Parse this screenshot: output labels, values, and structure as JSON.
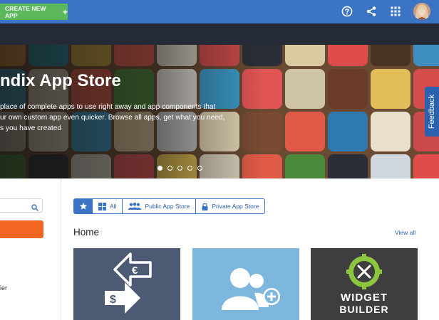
{
  "topbar": {
    "create_button": "CREATE NEW APP",
    "create_icon": "+",
    "icons": [
      "help-icon",
      "share-icon",
      "apps-grid-icon"
    ],
    "avatar": "user-avatar"
  },
  "hero": {
    "title": "ndix App Store",
    "lines": [
      "place of complete apps to use right away and app components that",
      "ur own custom app even quicker. Browse all apps, get what you need,",
      "s you have created"
    ],
    "slides": 5,
    "active_slide": 0
  },
  "feedback": {
    "label": "Feedback"
  },
  "sidebar": {
    "search": {
      "value": "",
      "placeholder": ""
    },
    "partial_text": "ier"
  },
  "filters": {
    "items": [
      {
        "label": "",
        "icon": "star-icon",
        "active": true
      },
      {
        "label": "All",
        "icon": "grid-icon",
        "active": false
      },
      {
        "label": "Public App Store",
        "icon": "users-icon",
        "active": false
      },
      {
        "label": "Private App Store",
        "icon": "lock-icon",
        "active": false
      }
    ]
  },
  "main": {
    "section_title": "Home",
    "view_all": "View all"
  },
  "cards": [
    {
      "name": "currency-exchange-app",
      "icon": "currency-exchange-icon",
      "color": "#4d5a74"
    },
    {
      "name": "add-users-app",
      "icon": "add-users-icon",
      "color": "#7eb7de"
    },
    {
      "name": "widget-builder-app",
      "icon": "gear-tools-icon",
      "color": "#3e3e3e",
      "text_line1": "WIDGET",
      "text_line2": "BUILDER"
    }
  ],
  "colors": {
    "topbar": "#3b74c5",
    "create_button": "#5cb85c",
    "accent_orange": "#f26522",
    "dark_bar": "#252b36"
  }
}
